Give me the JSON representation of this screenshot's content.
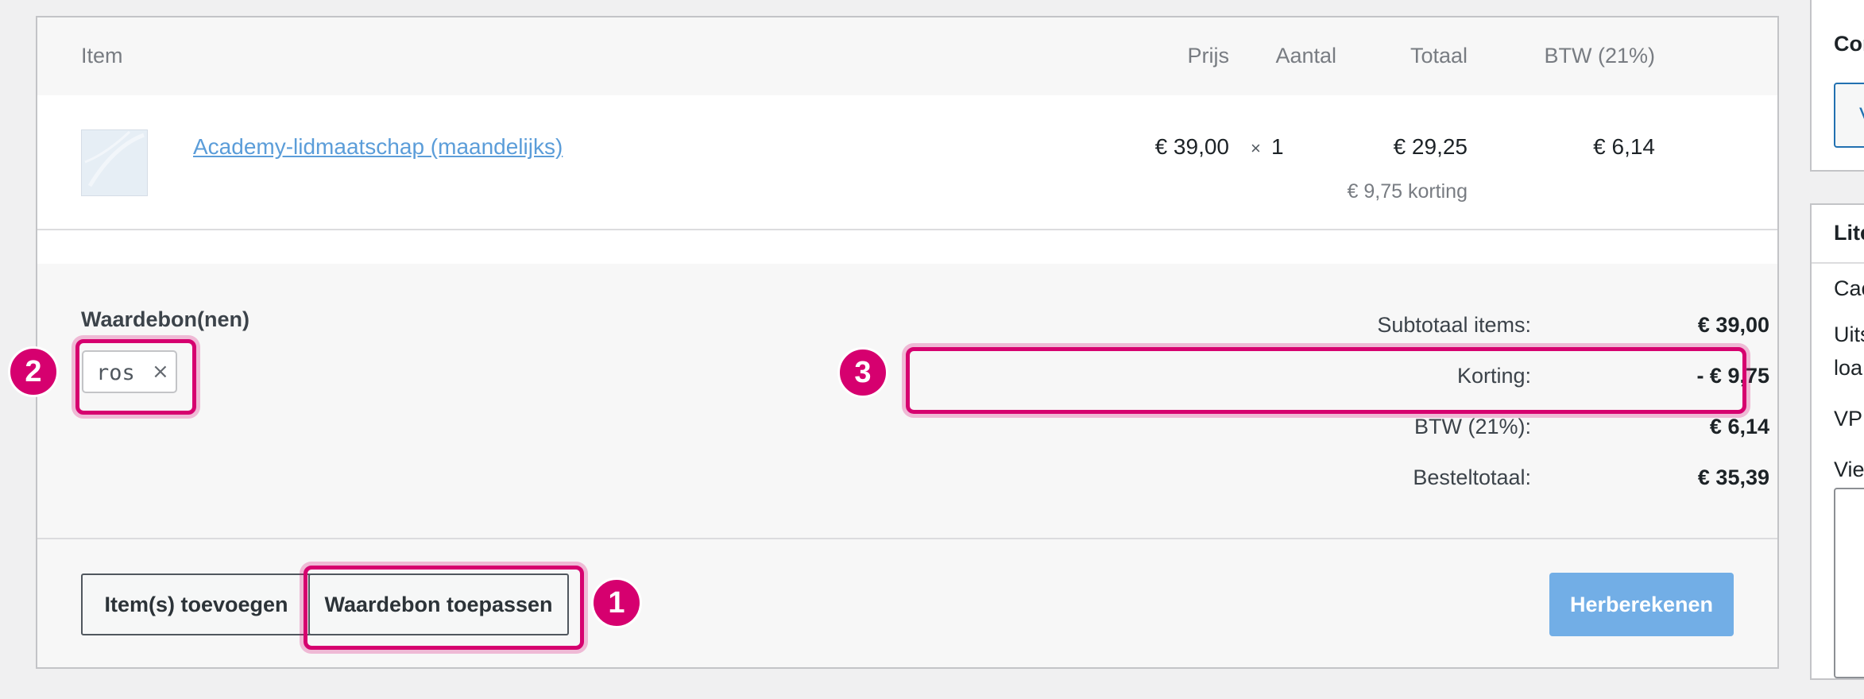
{
  "table": {
    "headers": {
      "item": "Item",
      "price": "Prijs",
      "quantity": "Aantal",
      "total": "Totaal",
      "vat": "BTW (21%)"
    },
    "rows": [
      {
        "thumbnail_icon": "product-thumbnail",
        "name": "Academy-lidmaatschap (maandelijks)",
        "price": "€ 39,00",
        "quantity": "1",
        "quantity_prefix": "×",
        "total": "€ 29,25",
        "discount_note": "€ 9,75 korting",
        "vat": "€ 6,14"
      }
    ]
  },
  "coupons": {
    "label": "Waardebon(nen)",
    "items": [
      {
        "code": "ros",
        "remove_icon": "close-icon",
        "remove_glyph": "×"
      }
    ]
  },
  "totals": [
    {
      "label": "Subtotaal items:",
      "value": "€ 39,00"
    },
    {
      "label": "Korting:",
      "value": "- € 9,75"
    },
    {
      "label": "BTW (21%):",
      "value": "€ 6,14"
    },
    {
      "label": "Besteltotaal:",
      "value": "€ 35,39"
    }
  ],
  "actions": {
    "add_items": "Item(s) toevoegen",
    "apply_coupon": "Waardebon toepassen",
    "recalculate": "Herberekenen"
  },
  "annotations": [
    {
      "number": "1",
      "target": "apply-coupon-button"
    },
    {
      "number": "2",
      "target": "coupon-chip"
    },
    {
      "number": "3",
      "target": "discount-row"
    }
  ],
  "sidebar": {
    "box1_title": "Cor",
    "box1_button": "V",
    "box2_title": "Lite",
    "box2_lines": [
      "Cac",
      "Uits",
      "loa",
      "VPI",
      "Vie"
    ]
  },
  "colors": {
    "annotation": "#d6006f",
    "link": "#5b9dd9",
    "primary_button": "#72aee6"
  }
}
